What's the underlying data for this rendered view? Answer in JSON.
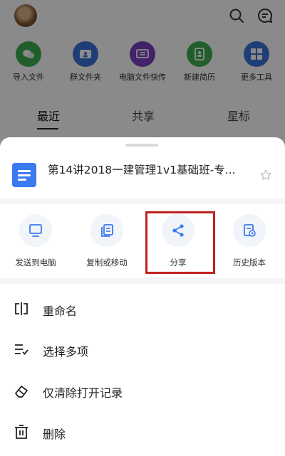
{
  "background": {
    "tools": [
      {
        "label": "导入文件",
        "color": "#3eae52",
        "icon": "wechat-icon"
      },
      {
        "label": "群文件夹",
        "color": "#3a73d9",
        "icon": "group-folder-icon"
      },
      {
        "label": "电脑文件快传",
        "color": "#7b3fc2",
        "icon": "transfer-icon"
      },
      {
        "label": "新建简历",
        "color": "#3eae52",
        "icon": "resume-icon"
      },
      {
        "label": "更多工具",
        "color": "#3a73d9",
        "icon": "grid-icon"
      }
    ],
    "tabs": [
      "最近",
      "共享",
      "星标"
    ]
  },
  "sheet": {
    "file_title": "第14讲2018一建管理1v1基础班-专...",
    "actions": [
      {
        "label": "发送到电脑",
        "icon": "computer-icon"
      },
      {
        "label": "复制或移动",
        "icon": "copy-move-icon"
      },
      {
        "label": "分享",
        "icon": "share-icon"
      },
      {
        "label": "历史版本",
        "icon": "history-icon"
      }
    ],
    "menu": [
      {
        "label": "重命名",
        "icon": "rename-icon"
      },
      {
        "label": "选择多项",
        "icon": "multi-select-icon"
      },
      {
        "label": "仅清除打开记录",
        "icon": "eraser-icon"
      },
      {
        "label": "删除",
        "icon": "trash-icon"
      }
    ]
  },
  "colors": {
    "accent": "#3a7bf0",
    "highlight": "#c02020"
  }
}
